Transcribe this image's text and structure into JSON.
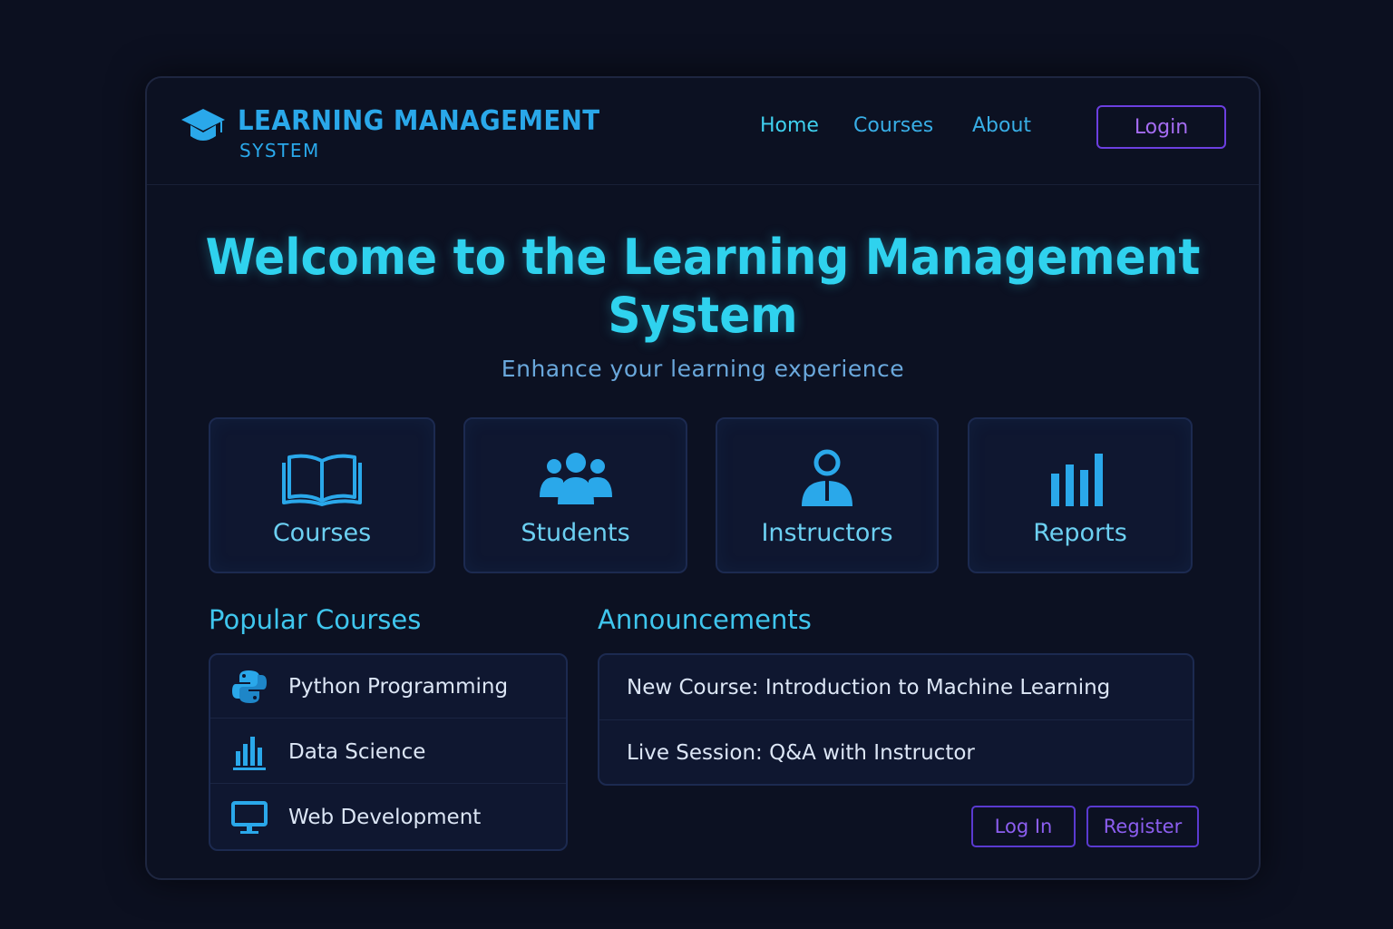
{
  "brand": {
    "title_line1": "LEARNING MANAGEMENT",
    "title_line2": "SYSTEM",
    "logo_icon": "graduation-cap-icon"
  },
  "nav": {
    "links": [
      "Home",
      "Courses",
      "About"
    ],
    "active": "Home",
    "login_label": "Login"
  },
  "hero": {
    "title_line1": "Welcome to the Learning Management",
    "title_line2": "System",
    "subtitle": "Enhance your learning experience"
  },
  "tiles": [
    {
      "label": "Courses",
      "icon": "open-book-icon"
    },
    {
      "label": "Students",
      "icon": "group-icon"
    },
    {
      "label": "Instructors",
      "icon": "instructor-icon"
    },
    {
      "label": "Reports",
      "icon": "bar-chart-icon"
    }
  ],
  "popular_courses": {
    "title": "Popular Courses",
    "items": [
      {
        "label": "Python Programming",
        "icon": "python-icon"
      },
      {
        "label": "Data Science",
        "icon": "chart-icon"
      },
      {
        "label": "Web Development",
        "icon": "monitor-icon"
      }
    ]
  },
  "announcements": {
    "title": "Announcements",
    "items": [
      "New Course: Introduction to Machine Learning",
      "Live Session: Q&A with Instructor"
    ]
  },
  "actions": {
    "login_label": "Log In",
    "register_label": "Register"
  },
  "colors": {
    "background": "#0c1020",
    "accent_cyan": "#2fd2ee",
    "accent_blue": "#2aa8ea",
    "accent_purple": "#6c3fe0"
  }
}
